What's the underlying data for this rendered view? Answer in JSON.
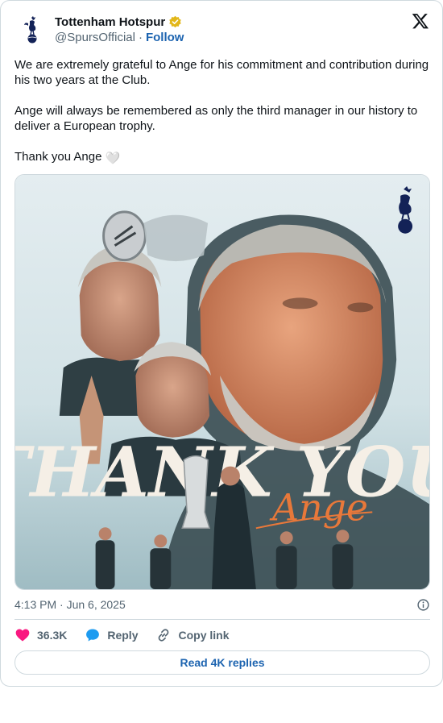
{
  "account": {
    "display_name": "Tottenham Hotspur",
    "handle": "@SpursOfficial",
    "separator": "·",
    "follow_label": "Follow",
    "avatar_icon": "cockerel-crest-icon",
    "verified_icon": "verified-gold-badge-icon",
    "verified_color": "#e2b719"
  },
  "platform_icon": "x-logo-icon",
  "tweet": {
    "paragraphs": [
      "We are extremely grateful to Ange for his commitment and contribution during his two years at the Club.",
      "Ange will always be remembered as only the third manager in our history to deliver a European trophy.",
      "Thank you Ange"
    ],
    "emoji": "🤍"
  },
  "media": {
    "headline": "THANK YOU",
    "script_name": "Ange",
    "accent_color": "#e8783a",
    "background_color": "#dfe9ec"
  },
  "timestamp": "4:13 PM · Jun 6, 2025",
  "actions": {
    "like_count": "36.3K",
    "reply_label": "Reply",
    "copy_link_label": "Copy link",
    "like_color": "#f91880",
    "reply_color": "#1d9bf0"
  },
  "read_replies_label": "Read 4K replies"
}
